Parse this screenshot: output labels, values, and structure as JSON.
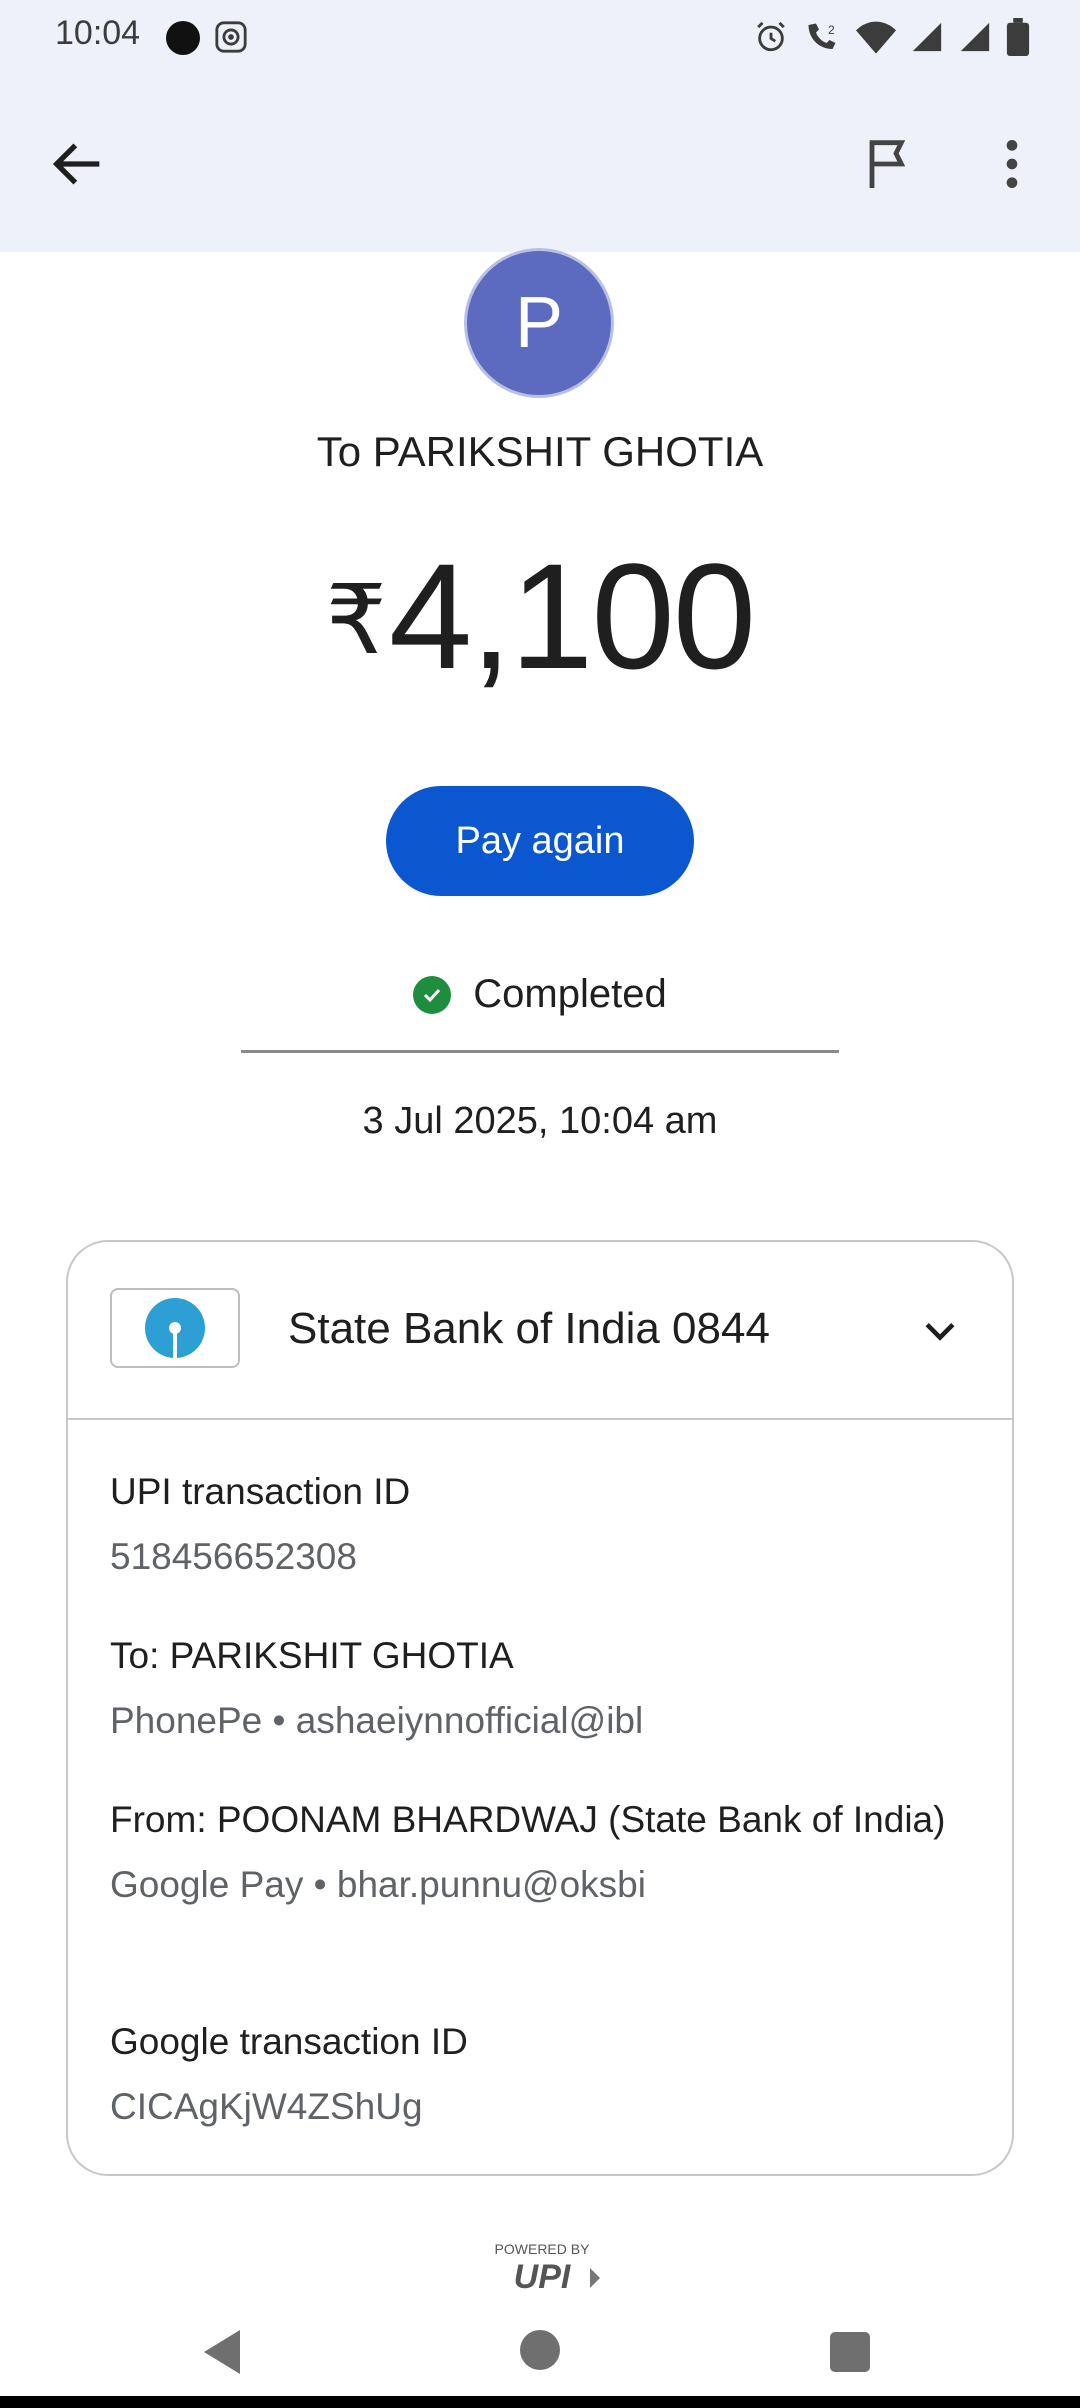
{
  "status_bar": {
    "time": "10:04"
  },
  "recipient": {
    "avatar_letter": "P",
    "title": "To PARIKSHIT GHOTIA"
  },
  "amount": {
    "currency": "₹",
    "value": "4,100"
  },
  "actions": {
    "pay_again": "Pay again"
  },
  "transaction_status": {
    "label": "Completed"
  },
  "datetime": "3 Jul 2025, 10:04 am",
  "account": {
    "bank_name": "State Bank of India 0844"
  },
  "details": {
    "upi_id_label": "UPI transaction ID",
    "upi_id_value": "518456652308",
    "to_label": "To: PARIKSHIT GHOTIA",
    "to_value": "PhonePe • ashaeiynnofficial@ibl",
    "from_label": "From: POONAM  BHARDWAJ (State Bank of India)",
    "from_value": "Google Pay • bhar.punnu@oksbi",
    "google_id_label": "Google transaction ID",
    "google_id_value": "CICAgKjW4ZShUg"
  },
  "footer": {
    "powered_by": "POWERED BY",
    "upi_text": "UPI"
  },
  "colors": {
    "primary": "#0b57d0",
    "avatar": "#5c6bc0",
    "success": "#1e8e3e",
    "header_bg": "#eef1fa",
    "sbi_blue": "#2e9fd4"
  }
}
